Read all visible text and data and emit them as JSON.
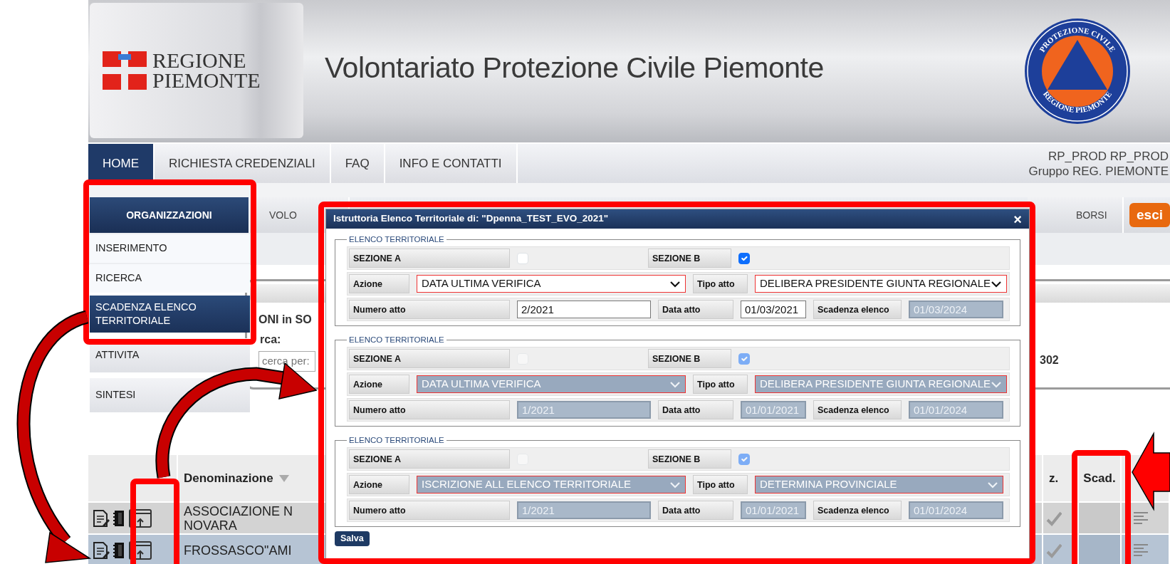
{
  "header": {
    "logo_line1": "REGIONE",
    "logo_line2": "PIEMONTE",
    "title": "Volontariato Protezione Civile Piemonte",
    "emblem_top": "PROTEZIONE CIVILE",
    "emblem_bottom": "REGIONE PIEMONTE"
  },
  "nav": {
    "tabs": [
      {
        "label": "HOME",
        "selected": true
      },
      {
        "label": "RICHIESTA CREDENZIALI",
        "selected": false
      },
      {
        "label": "FAQ",
        "selected": false
      },
      {
        "label": "INFO E CONTATTI",
        "selected": false
      }
    ],
    "user_line1": "RP_PROD RP_PROD",
    "user_line2": "Gruppo REG. PIEMONTE"
  },
  "subnav": {
    "tabs": [
      {
        "label": "ORGANIZZAZIONI",
        "selected": true
      },
      {
        "label": "VOLO",
        "selected": false
      },
      {
        "label": "BORSI",
        "selected": false
      }
    ],
    "logout": "esci"
  },
  "menu": {
    "items": [
      {
        "label": "INSERIMENTO",
        "selected": false
      },
      {
        "label": "RICERCA",
        "selected": false
      },
      {
        "label": "SCADENZA ELENCO TERRITORIALE",
        "selected": true
      },
      {
        "label": "ATTIVITA",
        "selected": false
      },
      {
        "label": "SINTESI",
        "selected": false
      }
    ]
  },
  "panel": {
    "heading": "ONI in SO",
    "search_label": "rca:",
    "search_placeholder": "cerca per:",
    "count": "302"
  },
  "table": {
    "columns": {
      "name": "Denominazione",
      "column_z": "z.",
      "deadline": "Scad."
    },
    "rows": [
      {
        "name_lines": [
          "ASSOCIAZIONE N",
          "NOVARA"
        ],
        "selected": false
      },
      {
        "name_lines": [
          "FROSSASCO\"AMI"
        ],
        "selected": true
      }
    ]
  },
  "dialog": {
    "title": "Istruttoria Elenco Territoriale di: \"Dpenna_TEST_EVO_2021\"",
    "close": "×",
    "save": "Salva",
    "sections": [
      {
        "legend": "ELENCO TERRITORIALE",
        "disabled": false,
        "section_a": {
          "label": "SEZIONE A",
          "checked": false
        },
        "section_b": {
          "label": "SEZIONE B",
          "checked": true
        },
        "action": {
          "label": "Azione",
          "value": "DATA ULTIMA VERIFICA"
        },
        "act_type": {
          "label": "Tipo atto",
          "value": "DELIBERA PRESIDENTE GIUNTA REGIONALE"
        },
        "act_number": {
          "label": "Numero atto",
          "value": "2/2021"
        },
        "act_date": {
          "label": "Data atto",
          "value": "01/03/2021"
        },
        "deadline": {
          "label": "Scadenza elenco",
          "value": "01/03/2024"
        }
      },
      {
        "legend": "ELENCO TERRITORIALE",
        "disabled": true,
        "section_a": {
          "label": "SEZIONE A",
          "checked": false
        },
        "section_b": {
          "label": "SEZIONE B",
          "checked": true
        },
        "action": {
          "label": "Azione",
          "value": "DATA ULTIMA VERIFICA"
        },
        "act_type": {
          "label": "Tipo atto",
          "value": "DELIBERA PRESIDENTE GIUNTA REGIONALE"
        },
        "act_number": {
          "label": "Numero atto",
          "value": "1/2021"
        },
        "act_date": {
          "label": "Data atto",
          "value": "01/01/2021"
        },
        "deadline": {
          "label": "Scadenza elenco",
          "value": "01/01/2024"
        }
      },
      {
        "legend": "ELENCO TERRITORIALE",
        "disabled": true,
        "section_a": {
          "label": "SEZIONE A",
          "checked": false
        },
        "section_b": {
          "label": "SEZIONE B",
          "checked": true
        },
        "action": {
          "label": "Azione",
          "value": "ISCRIZIONE ALL ELENCO TERRITORIALE"
        },
        "act_type": {
          "label": "Tipo atto",
          "value": "DETERMINA PROVINCIALE"
        },
        "act_number": {
          "label": "Numero atto",
          "value": "1/2021"
        },
        "act_date": {
          "label": "Data atto",
          "value": "01/01/2021"
        },
        "deadline": {
          "label": "Scadenza elenco",
          "value": "01/01/2024"
        }
      }
    ]
  }
}
